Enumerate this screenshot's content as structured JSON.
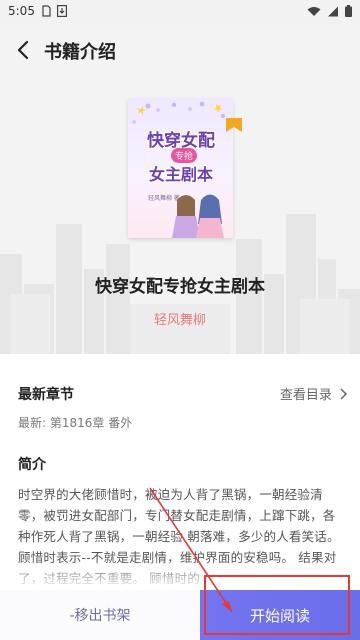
{
  "status": {
    "time": "5:05"
  },
  "header": {
    "title": "书籍介绍"
  },
  "book": {
    "title": "快穿女配专抢女主剧本",
    "author": "轻风舞柳",
    "cover": {
      "line1": "快穿女配",
      "line2": "专抢",
      "line3": "女主剧本",
      "author_small": "轻风舞柳 著"
    }
  },
  "chapters": {
    "section_label": "最新章节",
    "catalog_label": "查看目录",
    "latest": "最新: 第1816章 番外"
  },
  "intro": {
    "section_label": "简介",
    "text": "时空界的大佬顾惜时，被迫为人背了黑锅，一朝经验清零，被罚进女配部门，专门替女配走剧情，上蹿下跳，各种作死人背了黑锅，一朝经验 朝落难，多少的人看笑话。 顾惜时表示--不就是走剧情，维护界面的安稳吗。 结果对了，过程完全不重要。 顾惜时的"
  },
  "actions": {
    "remove_label": "-移出书架",
    "start_label": "开始阅读"
  },
  "colors": {
    "accent": "#6c6fea",
    "author": "#e57b7b",
    "annotation": "#e53935"
  },
  "icons": {
    "back": "back-arrow-icon",
    "chevron": "chevron-right-icon",
    "bookmark": "bookmark-icon"
  }
}
